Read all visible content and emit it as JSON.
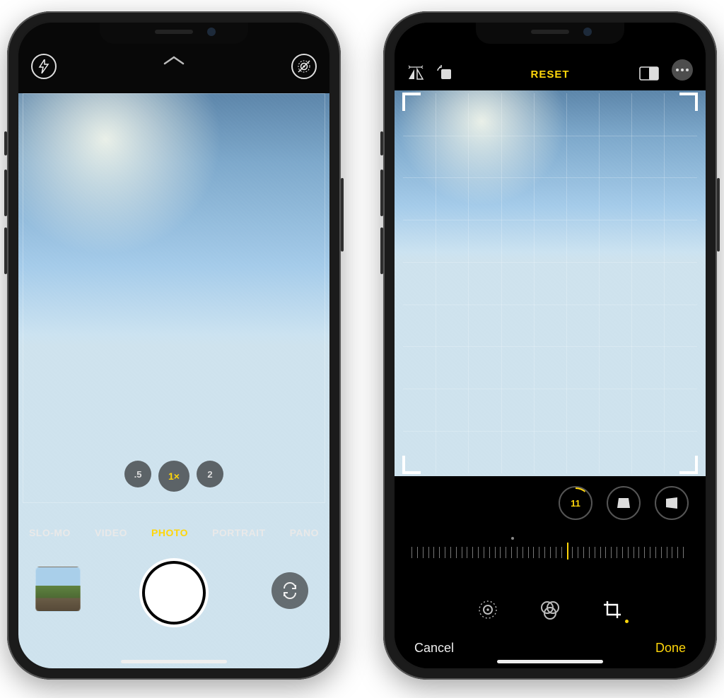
{
  "colors": {
    "accent": "#ffd60a"
  },
  "camera": {
    "zoom": {
      "options": [
        ".5",
        "1×",
        "2"
      ],
      "active_index": 1
    },
    "modes": {
      "options": [
        "SLO-MO",
        "VIDEO",
        "PHOTO",
        "PORTRAIT",
        "PANO"
      ],
      "active_index": 2
    }
  },
  "edit": {
    "reset_label": "RESET",
    "straighten_value": "11",
    "cancel_label": "Cancel",
    "done_label": "Done"
  }
}
